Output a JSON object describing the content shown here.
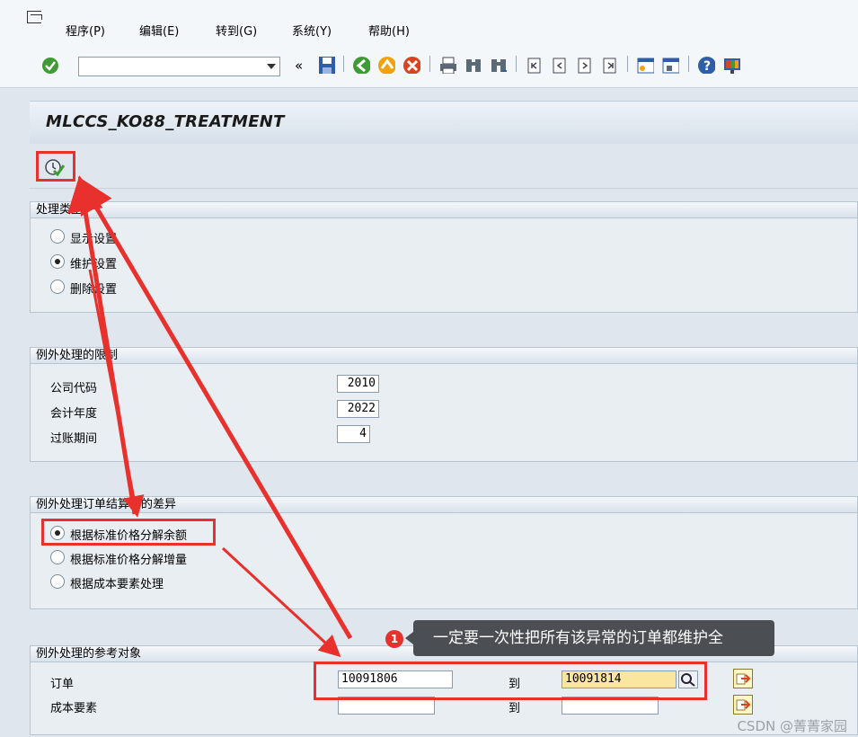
{
  "menu": [
    "程序(P)",
    "编辑(E)",
    "转到(G)",
    "系统(Y)",
    "帮助(H)"
  ],
  "toolbar": {
    "back_glyph": "«",
    "icons": [
      "enter-icon",
      "save-icon",
      "back-icon",
      "exit-icon",
      "cancel-icon",
      "print-icon",
      "find-icon",
      "find-next-icon",
      "first-page-icon",
      "prev-page-icon",
      "next-page-icon",
      "last-page-icon",
      "new-session-icon",
      "shortcut-icon",
      "help-icon",
      "layout-icon"
    ]
  },
  "page_title": "MLCCS_KO88_TREATMENT",
  "process_type": {
    "title": "处理类型",
    "options": [
      {
        "label": "显示设置",
        "checked": false
      },
      {
        "label": "维护设置",
        "checked": true
      },
      {
        "label": "删除设置",
        "checked": false
      }
    ]
  },
  "restrictions": {
    "title": "例外处理的限制",
    "fields": [
      {
        "label": "公司代码",
        "value": "2010"
      },
      {
        "label": "会计年度",
        "value": "2022"
      },
      {
        "label": "过账期间",
        "value": "4"
      }
    ]
  },
  "variance": {
    "title": "例外处理订单结算中的差异",
    "options": [
      {
        "label": "根据标准价格分解余额",
        "checked": true
      },
      {
        "label": "根据标准价格分解增量",
        "checked": false
      },
      {
        "label": "根据成本要素处理",
        "checked": false
      }
    ]
  },
  "reference": {
    "title": "例外处理的参考对象",
    "to_label": "到",
    "rows": [
      {
        "label": "订单",
        "from": "10091806",
        "to": "10091814"
      },
      {
        "label": "成本要素",
        "from": "",
        "to": ""
      }
    ]
  },
  "annotation": {
    "badge": "1",
    "text": "一定要一次性把所有该异常的订单都维护全"
  },
  "watermark": "CSDN @菁菁家园",
  "colors": {
    "accent_red": "#e8312d",
    "active_field": "#fbe6a0"
  }
}
